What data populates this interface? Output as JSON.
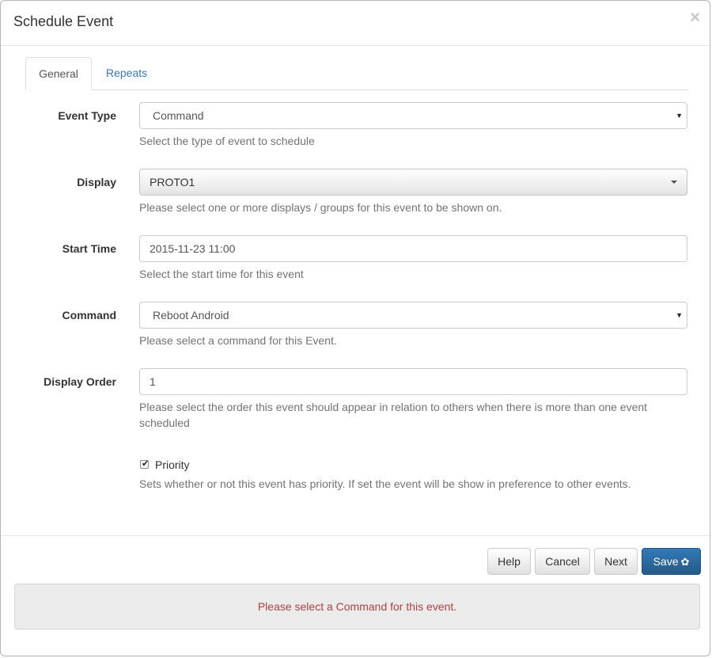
{
  "modal": {
    "title": "Schedule Event",
    "close_glyph": "×"
  },
  "tabs": [
    {
      "label": "General",
      "active": true
    },
    {
      "label": "Repeats",
      "active": false
    }
  ],
  "form": {
    "event_type": {
      "label": "Event Type",
      "value": "Command",
      "help": "Select the type of event to schedule"
    },
    "display": {
      "label": "Display",
      "value": "PROTO1",
      "help": "Please select one or more displays / groups for this event to be shown on."
    },
    "start_time": {
      "label": "Start Time",
      "value": "2015-11-23 11:00",
      "help": "Select the start time for this event"
    },
    "command": {
      "label": "Command",
      "value": "Reboot Android",
      "help": "Please select a command for this Event."
    },
    "display_order": {
      "label": "Display Order",
      "value": "1",
      "help": "Please select the order this event should appear in relation to others when there is more than one event scheduled"
    },
    "priority": {
      "label": "Priority",
      "checked": true,
      "help": "Sets whether or not this event has priority. If set the event will be show in preference to other events."
    }
  },
  "buttons": {
    "help": "Help",
    "cancel": "Cancel",
    "next": "Next",
    "save": "Save"
  },
  "alert": {
    "message": "Please select a Command for this event."
  },
  "icons": {
    "select_arrow": "▼",
    "checkmark": "✔",
    "gear": "✿"
  },
  "colors": {
    "primary": "#337ab7",
    "alert_text": "#a94442",
    "link": "#337ab7"
  }
}
